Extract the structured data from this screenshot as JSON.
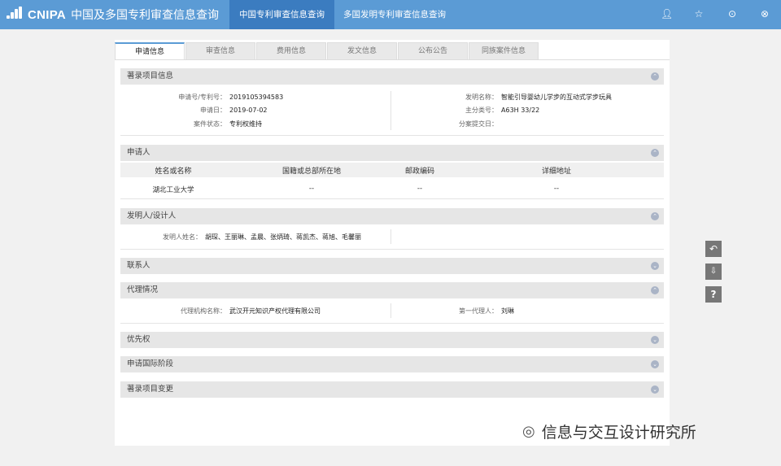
{
  "app": {
    "logo_text": "CNIPA",
    "logo_cn": "中国及多国专利审查信息查询",
    "nav_tabs": [
      {
        "label": "中国专利审查信息查询"
      },
      {
        "label": "多国发明专利审查信息查询"
      }
    ],
    "top_icons": [
      "user-icon",
      "star-icon",
      "swap-icon",
      "close-icon"
    ]
  },
  "tabs": [
    "申请信息",
    "审查信息",
    "费用信息",
    "发文信息",
    "公布公告",
    "同族案件信息"
  ],
  "sections": {
    "bibliographic": {
      "title": "著录项目信息",
      "fields": {
        "app_no_label": "申请号/专利号：",
        "app_no": "2019105394583",
        "date_label": "申请日：",
        "date": "2019-07-02",
        "status_label": "案件状态：",
        "status": "专利权维持",
        "name_label": "发明名称：",
        "name": "智能引导婴幼儿学步的互动式学步玩具",
        "class_label": "主分类号：",
        "class": "A63H 33/22",
        "divisional_label": "分案提交日："
      }
    },
    "applicant": {
      "title": "申请人",
      "columns": [
        "姓名或名称",
        "国籍或总部所在地",
        "邮政编码",
        "详细地址"
      ],
      "rows": [
        [
          "湖北工业大学",
          "--",
          "--",
          "--"
        ]
      ]
    },
    "inventor": {
      "title": "发明人/设计人",
      "label": "发明人姓名：",
      "value": "胡琛、王丽琳、孟晨、张炳琦、蒋凯杰、蒋旭、毛馨丽"
    },
    "contact": {
      "title": "联系人"
    },
    "agency": {
      "title": "代理情况",
      "agency_label": "代理机构名称：",
      "agency": "武汉开元知识产权代理有限公司",
      "agent_label": "第一代理人：",
      "agent": "刘琳"
    },
    "priority": {
      "title": "优先权"
    },
    "international": {
      "title": "申请国际阶段"
    },
    "changes": {
      "title": "著录项目变更"
    }
  },
  "side_buttons": [
    "back-icon",
    "export-icon",
    "help-icon"
  ],
  "watermark": "信息与交互设计研究所"
}
